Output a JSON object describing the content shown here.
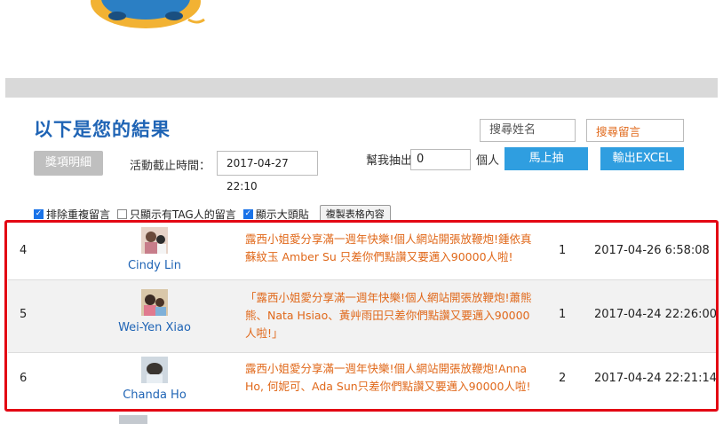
{
  "header": {
    "title": "以下是您的結果"
  },
  "search": {
    "name_placeholder": "搜尋姓名",
    "message_placeholder": "搜尋留言"
  },
  "controls": {
    "detail_button": "獎項明細",
    "deadline_label": "活動截止時間：",
    "deadline_value": "2017-04-27  22:10",
    "draw_label": "幫我抽出",
    "draw_count": "0",
    "draw_unit": "個人",
    "draw_button": "馬上抽",
    "excel_button": "輸出EXCEL"
  },
  "options": {
    "dedupe": {
      "label": "排除重複留言",
      "checked": true
    },
    "tagged_only": {
      "label": "只顯示有TAG人的留言",
      "checked": false
    },
    "show_avatar": {
      "label": "顯示大頭貼",
      "checked": true
    },
    "copy_button": "複製表格內容"
  },
  "rows": [
    {
      "index": "4",
      "name": "Cindy Lin",
      "message": "露西小姐愛分享滿一週年快樂!個人網站開張放鞭炮!鍾依真 蘇紋玉 Amber Su 只差你們點讚又要邁入90000人啦!",
      "count": "1",
      "date": "2017-04-26 6:58:08"
    },
    {
      "index": "5",
      "name": "Wei-Yen Xiao",
      "message": "「露西小姐愛分享滿一週年快樂!個人網站開張放鞭炮!蕭熊熊、Nata Hsiao、黃艸雨田只差你們點讚又要邁入90000人啦!」",
      "count": "1",
      "date": "2017-04-24 22:26:00"
    },
    {
      "index": "6",
      "name": "Chanda Ho",
      "message": "露西小姐愛分享滿一週年快樂!個人網站開張放鞭炮!Anna Ho, 何妮可、Ada Sun只差你們點讚又要邁入90000人啦!",
      "count": "2",
      "date": "2017-04-24 22:21:14"
    }
  ],
  "colors": {
    "accent": "#2f9ee0",
    "title": "#1f64b5",
    "message": "#e0681a",
    "highlight": "#e30613"
  }
}
